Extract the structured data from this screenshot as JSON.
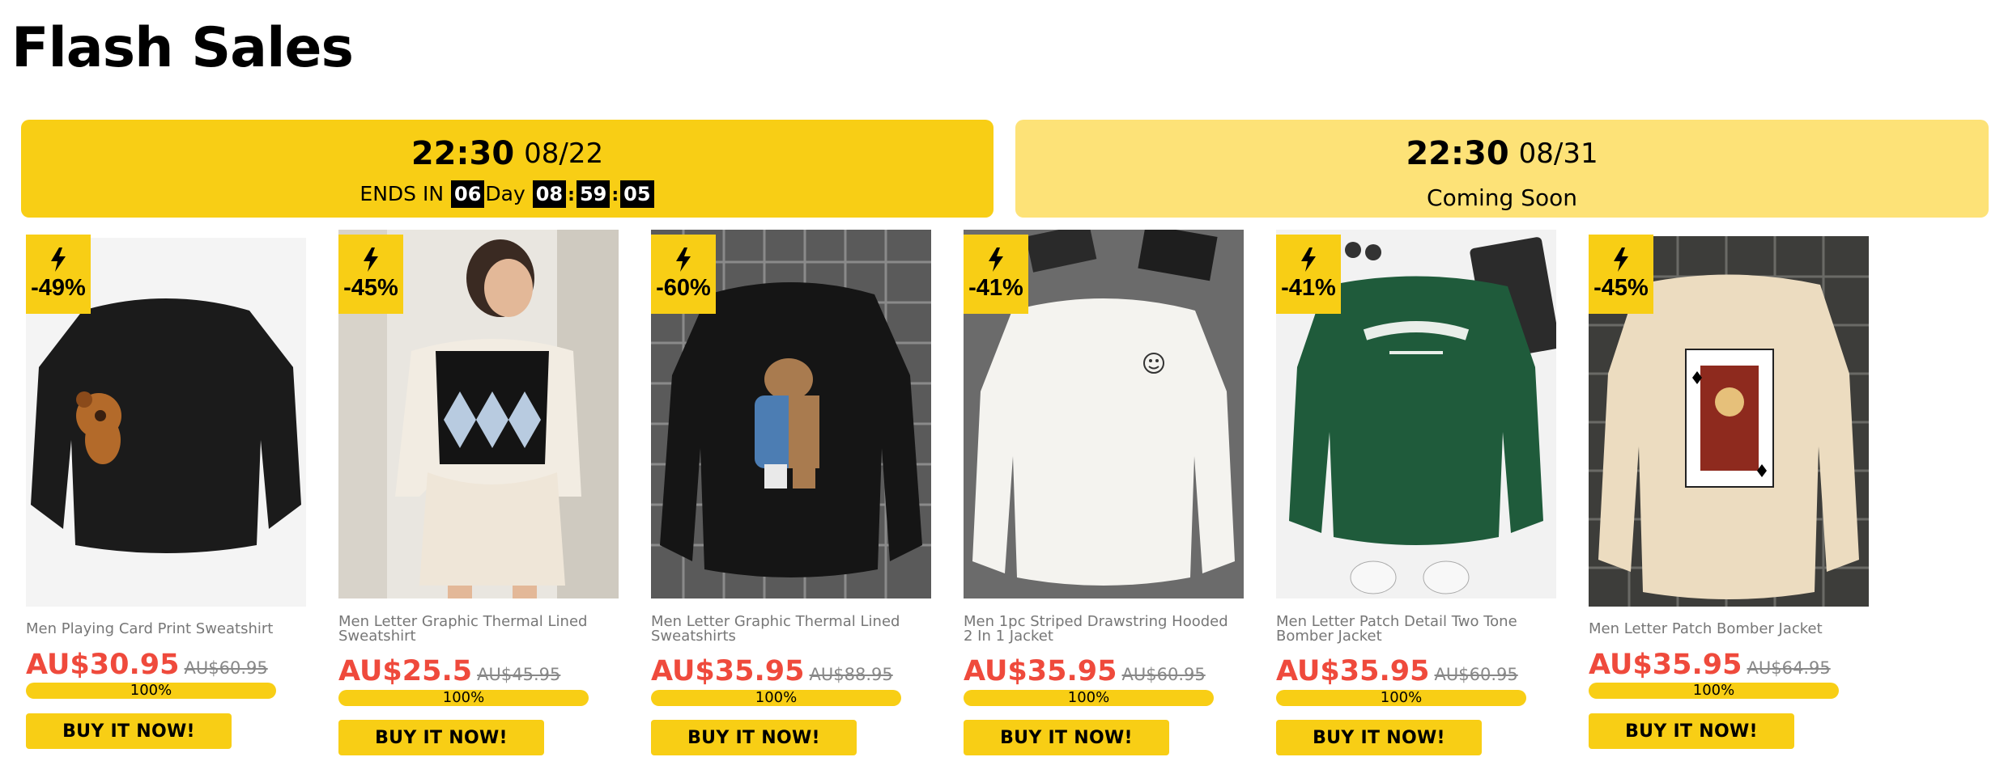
{
  "page": {
    "title": "Flash Sales"
  },
  "sessions": [
    {
      "time": "22:30",
      "date": "08/22",
      "ends_in_label": "ENDS IN",
      "days": "06",
      "day_label": "Day",
      "hours": "08",
      "minutes": "59",
      "seconds": "05",
      "separator": ":"
    },
    {
      "time": "22:30",
      "date": "08/31",
      "status": "Coming Soon"
    }
  ],
  "products": [
    {
      "discount": "-49%",
      "title": "Men Playing Card Print Sweatshirt",
      "price": "AU$30.95",
      "original_price": "AU$60.95",
      "progress_label": "100%",
      "sold_fraction": 1.0,
      "buy_label": "BUY IT NOW!",
      "image": "black sweatshirt with teddy bear"
    },
    {
      "discount": "-45%",
      "title": "Men Letter Graphic Thermal Lined Sweatshirt",
      "price": "AU$25.5",
      "original_price": "AU$45.95",
      "progress_label": "100%",
      "sold_fraction": 1.0,
      "buy_label": "BUY IT NOW!",
      "image": "woman in argyle sweater vest"
    },
    {
      "discount": "-60%",
      "title": "Men Letter Graphic Thermal Lined Sweatshirts",
      "price": "AU$35.95",
      "original_price": "AU$88.95",
      "progress_label": "100%",
      "sold_fraction": 1.0,
      "buy_label": "BUY IT NOW!",
      "image": "black sweatshirt with bear graphic"
    },
    {
      "discount": "-41%",
      "title": "Men 1pc Striped Drawstring Hooded 2 In 1 Jacket",
      "price": "AU$35.95",
      "original_price": "AU$60.95",
      "progress_label": "100%",
      "sold_fraction": 1.0,
      "buy_label": "BUY IT NOW!",
      "image": "white sweatshirt with smiley"
    },
    {
      "discount": "-41%",
      "title": "Men Letter Patch Detail Two Tone Bomber Jacket",
      "price": "AU$35.95",
      "original_price": "AU$60.95",
      "progress_label": "100%",
      "sold_fraction": 1.0,
      "buy_label": "BUY IT NOW!",
      "image": "green Los Angeles sweatshirt"
    },
    {
      "discount": "-45%",
      "title": "Men Letter Patch Bomber Jacket",
      "price": "AU$35.95",
      "original_price": "AU$64.95",
      "progress_label": "100%",
      "sold_fraction": 1.0,
      "buy_label": "BUY IT NOW!",
      "image": "beige sweatshirt with king card"
    }
  ],
  "colors": {
    "accent": "#f8ce15",
    "accent_light": "#fde277",
    "sale_price": "#ef4a3c",
    "muted": "#888888"
  }
}
